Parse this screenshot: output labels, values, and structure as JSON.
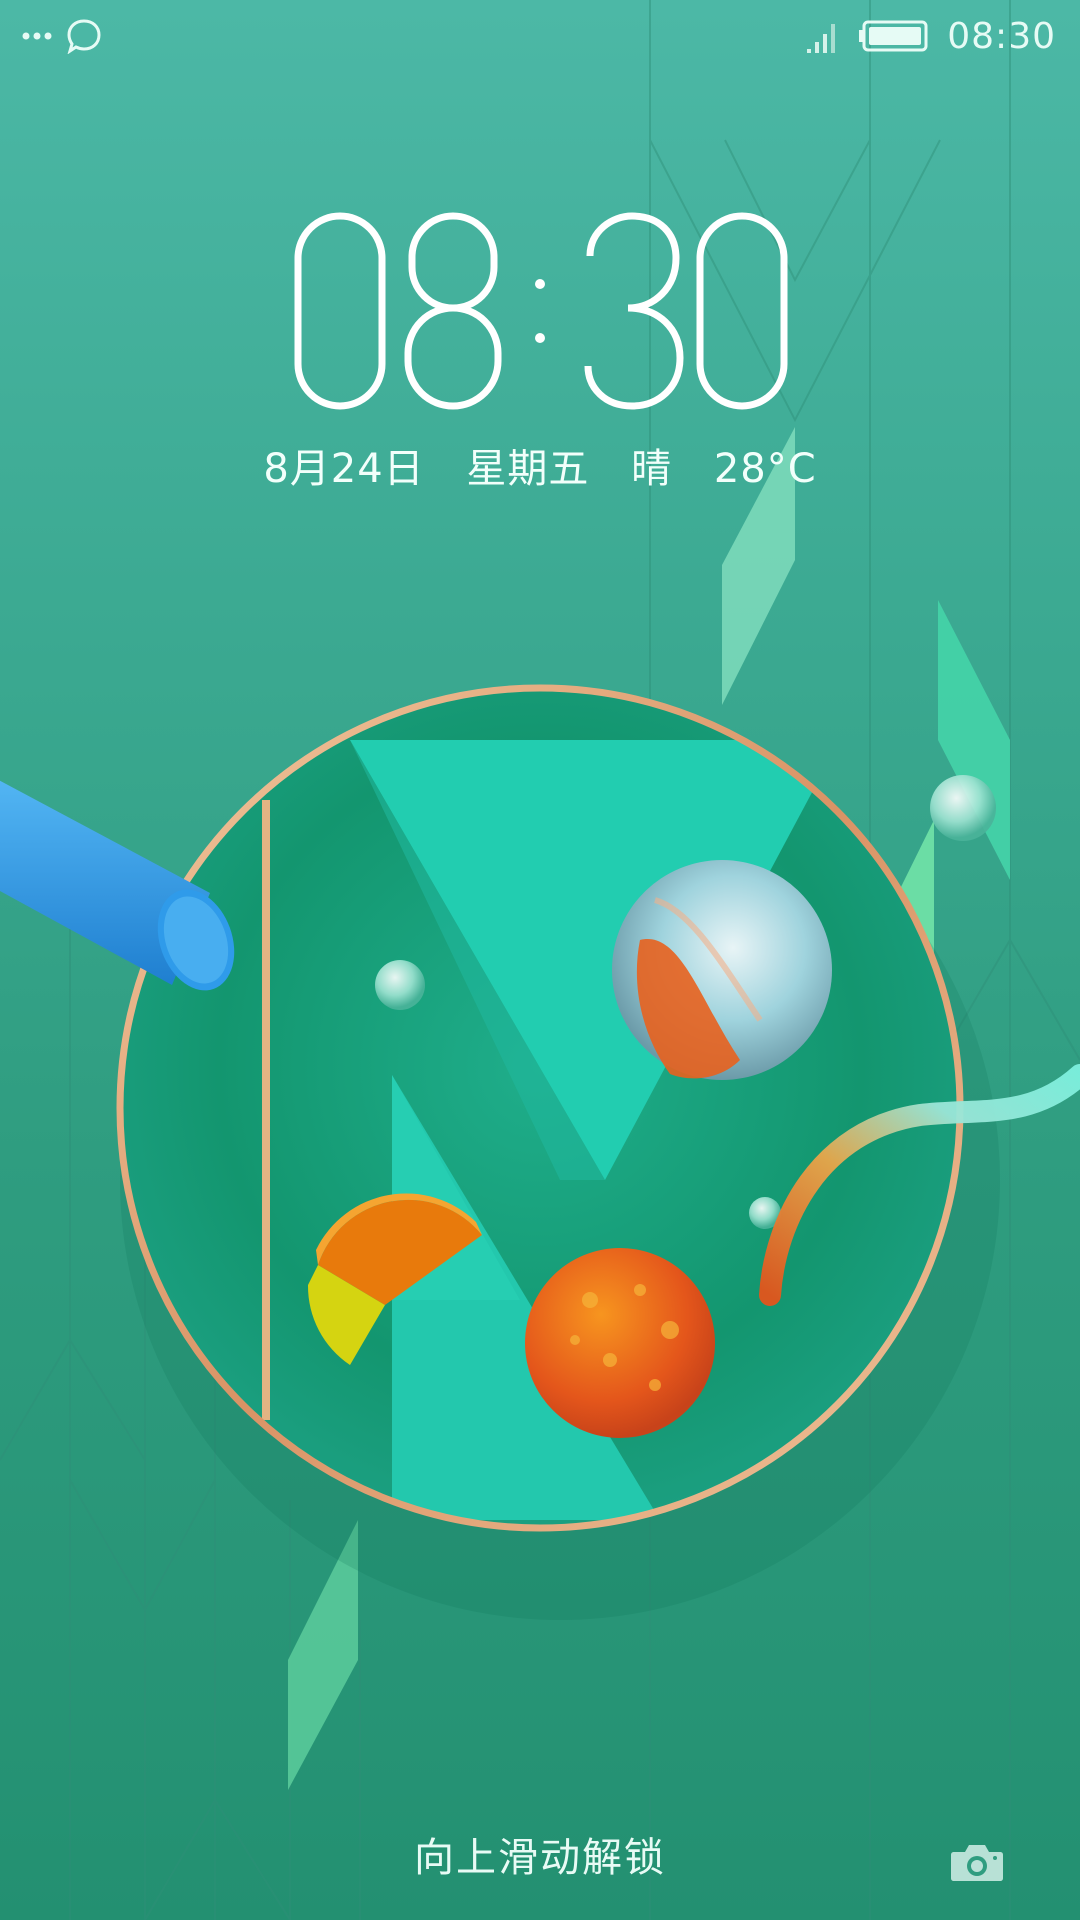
{
  "status_bar": {
    "more_icon": "more-dots-icon",
    "chat_icon": "chat-bubble-icon",
    "signal_icon": "signal-icon",
    "battery_icon": "battery-icon",
    "time": "08:30"
  },
  "lockscreen": {
    "clock": {
      "hours": "08",
      "minutes": "30"
    },
    "date": "8月24日",
    "weekday": "星期五",
    "weather": "晴",
    "temperature": "28°C",
    "unlock_hint": "向上滑动解锁",
    "camera_icon": "camera-icon"
  },
  "colors": {
    "background_top": "#4cb8a6",
    "background_bottom": "#239071",
    "ring_gold": "#e3a97a",
    "accent_teal": "#22cdb0",
    "accent_orange": "#e8621e",
    "accent_blue": "#2f9bea"
  }
}
